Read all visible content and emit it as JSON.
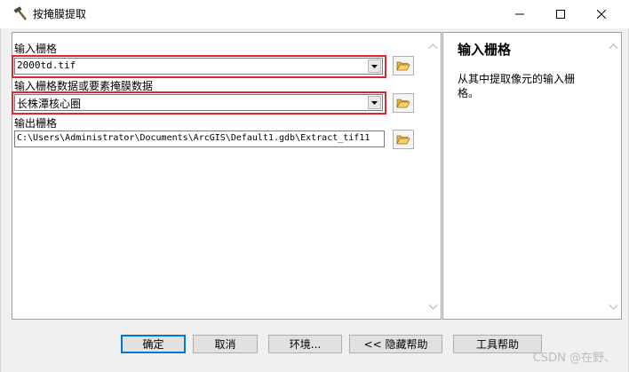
{
  "window": {
    "title": "按掩膜提取",
    "icon": "hammer-icon"
  },
  "form": {
    "input_raster": {
      "label": "输入栅格",
      "value": "2000td.tif"
    },
    "mask_data": {
      "label": "输入栅格数据或要素掩膜数据",
      "value": "长株潭核心圈"
    },
    "output_raster": {
      "label": "输出栅格",
      "value": "C:\\Users\\Administrator\\Documents\\ArcGIS\\Default1.gdb\\Extract_tif11"
    }
  },
  "help": {
    "title": "输入栅格",
    "body": "从其中提取像元的输入栅格。"
  },
  "buttons": {
    "ok": "确定",
    "cancel": "取消",
    "environments": "环境...",
    "hide_help": "<< 隐藏帮助",
    "tool_help": "工具帮助"
  },
  "watermark": "CSDN @在野、",
  "colors": {
    "highlight": "#e0262b",
    "default_button_border": "#0078d7"
  }
}
